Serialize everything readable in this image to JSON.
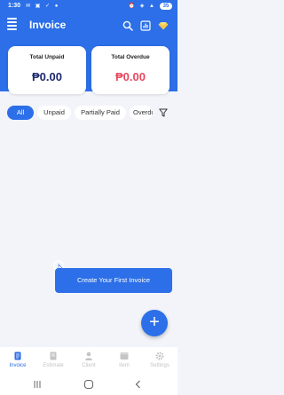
{
  "status_bar": {
    "time": "1:30",
    "left_icons": [
      "mail-icon",
      "image-icon",
      "check-icon",
      "mic-icon"
    ],
    "right_icons": [
      "alarm-icon",
      "wifi-icon",
      "signal-icon"
    ],
    "battery": "35"
  },
  "header": {
    "title": "Invoice",
    "actions": [
      "search-icon",
      "report-icon",
      "premium-gem-icon"
    ]
  },
  "summary": {
    "unpaid_label": "Total Unpaid",
    "unpaid_value": "₱0.00",
    "overdue_label": "Total Overdue",
    "overdue_value": "₱0.00"
  },
  "filters": {
    "tabs": [
      "All",
      "Unpaid",
      "Partially Paid",
      "Overdue"
    ],
    "active": "All"
  },
  "tooltip": {
    "text": "Create Your First Invoice"
  },
  "fab": {
    "label": "+"
  },
  "bottom_nav": {
    "items": [
      "Invoice",
      "Estimate",
      "Client",
      "Item",
      "Settings"
    ],
    "active": "Invoice"
  },
  "colors": {
    "primary": "#2c6fe8",
    "unpaid": "#1e2a6e",
    "overdue": "#e8475f",
    "background": "#f2f4fa"
  }
}
